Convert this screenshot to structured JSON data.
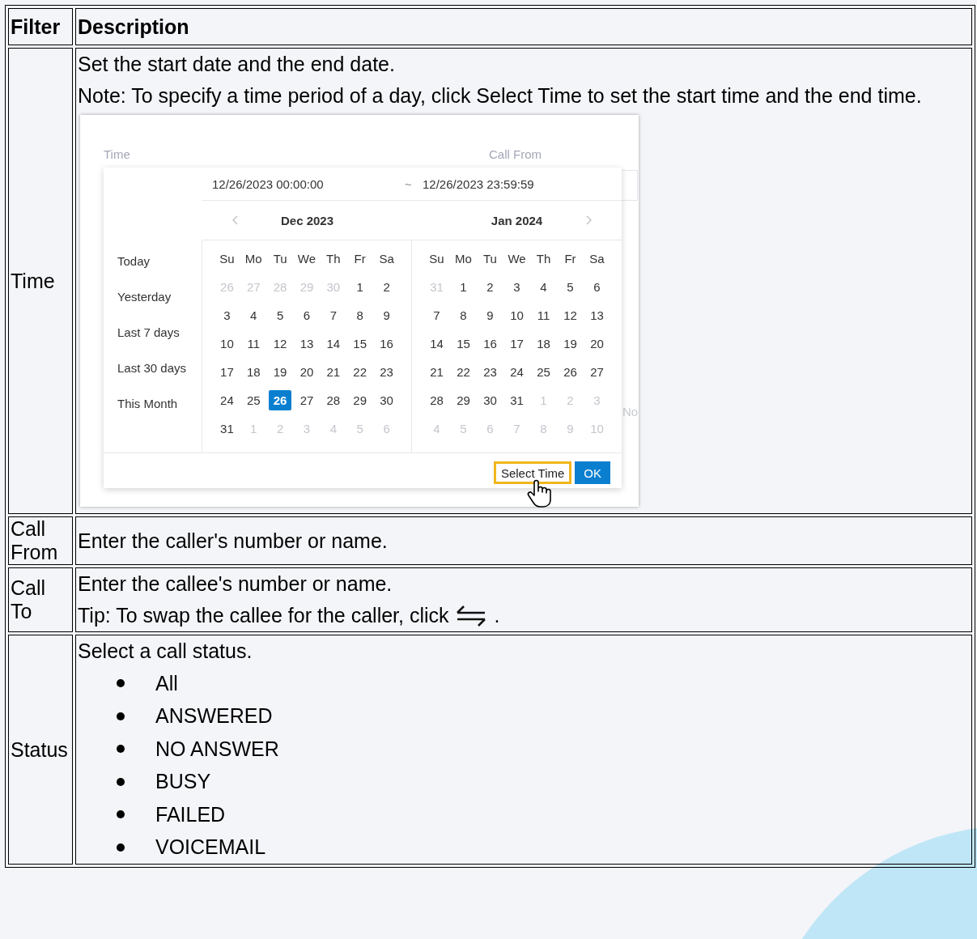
{
  "table": {
    "columns": [
      "Filter",
      "Description"
    ],
    "rows": [
      {
        "kind": "time",
        "filter": "Time",
        "lines": [
          "Set the start date and the end date.",
          "Note: To specify a time period of a day, click Select Time to set the start time and the end time."
        ],
        "screenshot": {
          "form_labels": [
            "Time",
            "Call From"
          ],
          "start": "12/26/2023 00:00:00",
          "separator": "~",
          "end": "12/26/2023 23:59:59",
          "fragment": "No",
          "shortcuts": [
            "Today",
            "Yesterday",
            "Last 7 days",
            "Last 30 days",
            "This Month"
          ],
          "months": [
            {
              "title": "Dec 2023",
              "prev_arrow": true,
              "next_arrow": false,
              "weekdays": [
                "Su",
                "Mo",
                "Tu",
                "We",
                "Th",
                "Fr",
                "Sa"
              ],
              "weeks": [
                [
                  {
                    "day": "26",
                    "outside": true,
                    "selected": false
                  },
                  {
                    "day": "27",
                    "outside": true,
                    "selected": false
                  },
                  {
                    "day": "28",
                    "outside": true,
                    "selected": false
                  },
                  {
                    "day": "29",
                    "outside": true,
                    "selected": false
                  },
                  {
                    "day": "30",
                    "outside": true,
                    "selected": false
                  },
                  {
                    "day": "1",
                    "outside": false,
                    "selected": false
                  },
                  {
                    "day": "2",
                    "outside": false,
                    "selected": false
                  }
                ],
                [
                  {
                    "day": "3",
                    "outside": false,
                    "selected": false
                  },
                  {
                    "day": "4",
                    "outside": false,
                    "selected": false
                  },
                  {
                    "day": "5",
                    "outside": false,
                    "selected": false
                  },
                  {
                    "day": "6",
                    "outside": false,
                    "selected": false
                  },
                  {
                    "day": "7",
                    "outside": false,
                    "selected": false
                  },
                  {
                    "day": "8",
                    "outside": false,
                    "selected": false
                  },
                  {
                    "day": "9",
                    "outside": false,
                    "selected": false
                  }
                ],
                [
                  {
                    "day": "10",
                    "outside": false,
                    "selected": false
                  },
                  {
                    "day": "11",
                    "outside": false,
                    "selected": false
                  },
                  {
                    "day": "12",
                    "outside": false,
                    "selected": false
                  },
                  {
                    "day": "13",
                    "outside": false,
                    "selected": false
                  },
                  {
                    "day": "14",
                    "outside": false,
                    "selected": false
                  },
                  {
                    "day": "15",
                    "outside": false,
                    "selected": false
                  },
                  {
                    "day": "16",
                    "outside": false,
                    "selected": false
                  }
                ],
                [
                  {
                    "day": "17",
                    "outside": false,
                    "selected": false
                  },
                  {
                    "day": "18",
                    "outside": false,
                    "selected": false
                  },
                  {
                    "day": "19",
                    "outside": false,
                    "selected": false
                  },
                  {
                    "day": "20",
                    "outside": false,
                    "selected": false
                  },
                  {
                    "day": "21",
                    "outside": false,
                    "selected": false
                  },
                  {
                    "day": "22",
                    "outside": false,
                    "selected": false
                  },
                  {
                    "day": "23",
                    "outside": false,
                    "selected": false
                  }
                ],
                [
                  {
                    "day": "24",
                    "outside": false,
                    "selected": false
                  },
                  {
                    "day": "25",
                    "outside": false,
                    "selected": false
                  },
                  {
                    "day": "26",
                    "outside": false,
                    "selected": true
                  },
                  {
                    "day": "27",
                    "outside": false,
                    "selected": false
                  },
                  {
                    "day": "28",
                    "outside": false,
                    "selected": false
                  },
                  {
                    "day": "29",
                    "outside": false,
                    "selected": false
                  },
                  {
                    "day": "30",
                    "outside": false,
                    "selected": false
                  }
                ],
                [
                  {
                    "day": "31",
                    "outside": false,
                    "selected": false
                  },
                  {
                    "day": "1",
                    "outside": true,
                    "selected": false
                  },
                  {
                    "day": "2",
                    "outside": true,
                    "selected": false
                  },
                  {
                    "day": "3",
                    "outside": true,
                    "selected": false
                  },
                  {
                    "day": "4",
                    "outside": true,
                    "selected": false
                  },
                  {
                    "day": "5",
                    "outside": true,
                    "selected": false
                  },
                  {
                    "day": "6",
                    "outside": true,
                    "selected": false
                  }
                ]
              ]
            },
            {
              "title": "Jan 2024",
              "prev_arrow": false,
              "next_arrow": true,
              "weekdays": [
                "Su",
                "Mo",
                "Tu",
                "We",
                "Th",
                "Fr",
                "Sa"
              ],
              "weeks": [
                [
                  {
                    "day": "31",
                    "outside": true,
                    "selected": false
                  },
                  {
                    "day": "1",
                    "outside": false,
                    "selected": false
                  },
                  {
                    "day": "2",
                    "outside": false,
                    "selected": false
                  },
                  {
                    "day": "3",
                    "outside": false,
                    "selected": false
                  },
                  {
                    "day": "4",
                    "outside": false,
                    "selected": false
                  },
                  {
                    "day": "5",
                    "outside": false,
                    "selected": false
                  },
                  {
                    "day": "6",
                    "outside": false,
                    "selected": false
                  }
                ],
                [
                  {
                    "day": "7",
                    "outside": false,
                    "selected": false
                  },
                  {
                    "day": "8",
                    "outside": false,
                    "selected": false
                  },
                  {
                    "day": "9",
                    "outside": false,
                    "selected": false
                  },
                  {
                    "day": "10",
                    "outside": false,
                    "selected": false
                  },
                  {
                    "day": "11",
                    "outside": false,
                    "selected": false
                  },
                  {
                    "day": "12",
                    "outside": false,
                    "selected": false
                  },
                  {
                    "day": "13",
                    "outside": false,
                    "selected": false
                  }
                ],
                [
                  {
                    "day": "14",
                    "outside": false,
                    "selected": false
                  },
                  {
                    "day": "15",
                    "outside": false,
                    "selected": false
                  },
                  {
                    "day": "16",
                    "outside": false,
                    "selected": false
                  },
                  {
                    "day": "17",
                    "outside": false,
                    "selected": false
                  },
                  {
                    "day": "18",
                    "outside": false,
                    "selected": false
                  },
                  {
                    "day": "19",
                    "outside": false,
                    "selected": false
                  },
                  {
                    "day": "20",
                    "outside": false,
                    "selected": false
                  }
                ],
                [
                  {
                    "day": "21",
                    "outside": false,
                    "selected": false
                  },
                  {
                    "day": "22",
                    "outside": false,
                    "selected": false
                  },
                  {
                    "day": "23",
                    "outside": false,
                    "selected": false
                  },
                  {
                    "day": "24",
                    "outside": false,
                    "selected": false
                  },
                  {
                    "day": "25",
                    "outside": false,
                    "selected": false
                  },
                  {
                    "day": "26",
                    "outside": false,
                    "selected": false
                  },
                  {
                    "day": "27",
                    "outside": false,
                    "selected": false
                  }
                ],
                [
                  {
                    "day": "28",
                    "outside": false,
                    "selected": false
                  },
                  {
                    "day": "29",
                    "outside": false,
                    "selected": false
                  },
                  {
                    "day": "30",
                    "outside": false,
                    "selected": false
                  },
                  {
                    "day": "31",
                    "outside": false,
                    "selected": false
                  },
                  {
                    "day": "1",
                    "outside": true,
                    "selected": false
                  },
                  {
                    "day": "2",
                    "outside": true,
                    "selected": false
                  },
                  {
                    "day": "3",
                    "outside": true,
                    "selected": false
                  }
                ],
                [
                  {
                    "day": "4",
                    "outside": true,
                    "selected": false
                  },
                  {
                    "day": "5",
                    "outside": true,
                    "selected": false
                  },
                  {
                    "day": "6",
                    "outside": true,
                    "selected": false
                  },
                  {
                    "day": "7",
                    "outside": true,
                    "selected": false
                  },
                  {
                    "day": "8",
                    "outside": true,
                    "selected": false
                  },
                  {
                    "day": "9",
                    "outside": true,
                    "selected": false
                  },
                  {
                    "day": "10",
                    "outside": true,
                    "selected": false
                  }
                ]
              ]
            }
          ],
          "buttons": [
            {
              "label": "Select Time",
              "kind": "plain",
              "highlighted": true
            },
            {
              "label": "OK",
              "kind": "primary",
              "highlighted": false
            }
          ]
        }
      },
      {
        "kind": "text",
        "filter": "Call From",
        "lines": [
          "Enter the caller's number or name."
        ]
      },
      {
        "kind": "tip",
        "filter": "Call To",
        "lines": [
          "Enter the callee's number or name."
        ],
        "tip": "Tip: To swap the callee for the caller, click",
        "tip_end": "."
      },
      {
        "kind": "list",
        "filter": "Status",
        "lines": [
          "Select a call status."
        ],
        "bullets": [
          "All",
          "ANSWERED",
          "NO ANSWER",
          "BUSY",
          "FAILED",
          "VOICEMAIL"
        ]
      }
    ]
  }
}
